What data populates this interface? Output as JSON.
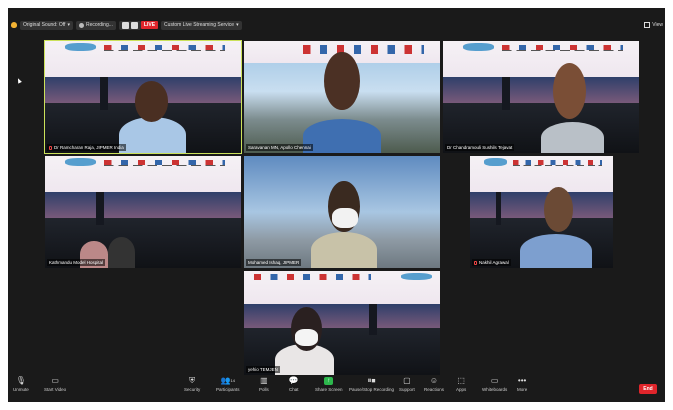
{
  "topbar": {
    "sound_label": "Original Sound: Off",
    "recording_label": "Recording...",
    "live_label": "LIVE",
    "streaming_label": "Custom Live Streaming Service",
    "view_label": "View"
  },
  "participants": [
    {
      "name": "Dr Ramcharan Raja, JIPMER India"
    },
    {
      "name": "Saravanan MN, Apollo Chennai"
    },
    {
      "name": "Dr Chandramouli Sushils Tejavat"
    },
    {
      "name": "Kathmandu Model Hospital"
    },
    {
      "name": "Mohamed Ishaq, JIPMER"
    },
    {
      "name": "Nakhil Agrawal"
    },
    {
      "name": "yehio TEMJEN"
    }
  ],
  "toolbar": {
    "unmute": "Unmute",
    "start_video": "Start Video",
    "security": "Security",
    "participants": "Participants",
    "participants_count": "14",
    "polls": "Polls",
    "chat": "Chat",
    "share_screen": "Share Screen",
    "pause_recording": "Pause/Stop Recording",
    "support": "Support",
    "reactions": "Reactions",
    "apps": "Apps",
    "whiteboards": "Whiteboards",
    "more": "More",
    "end": "End"
  },
  "colors": {
    "live": "#e0252b",
    "active_speaker": "#cbe15a",
    "share_green": "#2db84d"
  }
}
